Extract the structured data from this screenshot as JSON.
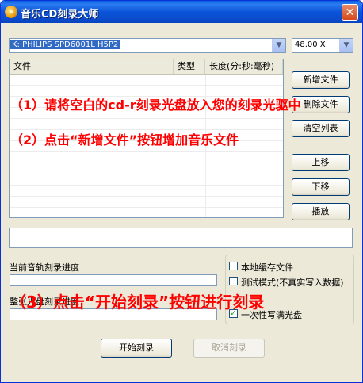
{
  "window": {
    "title": "音乐CD刻录大师",
    "close_glyph": "✕"
  },
  "drive_combo": {
    "value": "K: PHILIPS SPD6001L H5P2",
    "arrow": "▼"
  },
  "speed_combo": {
    "value": "48.00 X",
    "arrow": "▼"
  },
  "file_list": {
    "columns": [
      "文件",
      "类型",
      "长度(分:秒:毫秒)"
    ]
  },
  "buttons": {
    "add_file": "新增文件",
    "delete_file": "删除文件",
    "clear_list": "清空列表",
    "move_up": "上移",
    "move_down": "下移",
    "play": "播放",
    "start_burn": "开始刻录",
    "cancel_burn": "取消刻录"
  },
  "progress": {
    "track_label": "当前音轨刻录进度",
    "disc_label": "整张光盘刻录进度"
  },
  "options": [
    {
      "label": "本地缓存文件",
      "checked": false
    },
    {
      "label": "测试模式(不真实写入数据)",
      "checked": false
    },
    {
      "label": "一次性写满光盘",
      "checked": true
    }
  ],
  "annotations": {
    "step1": "（1）请将空白的cd-r刻录光盘放入您的刻录光驱中",
    "step2": "（2）点击“新增文件”按钮增加音乐文件",
    "step3": "（3）点击“开始刻录”按钮进行刻录"
  },
  "colors": {
    "annotation": "#ff0000",
    "titlebar": "#0a5fe0"
  }
}
